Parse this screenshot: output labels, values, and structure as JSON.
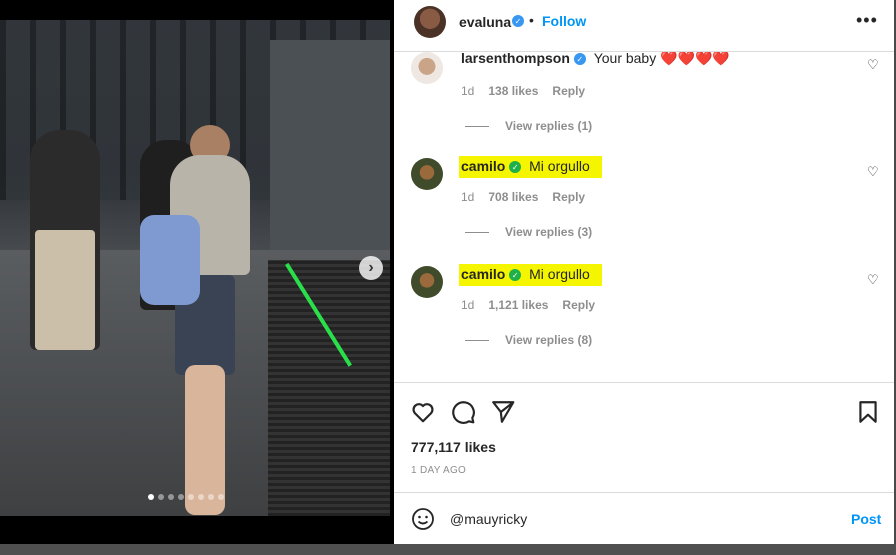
{
  "post": {
    "author": "evaluna",
    "follow_label": "Follow",
    "separator": "•",
    "more_label": "•••",
    "likes": "777,117 likes",
    "time": "1 DAY AGO"
  },
  "photo": {
    "next_label": "›",
    "dots_count": 8,
    "active_dot": 1
  },
  "comments": [
    {
      "username": "larsenthompson",
      "text": "Your baby ❤️❤️❤️❤️",
      "age": "1d",
      "likes": "138 likes",
      "reply_label": "Reply",
      "view_replies": "View replies (1)",
      "highlighted": false
    },
    {
      "username": "camilo",
      "text": "Mi orgullo",
      "age": "1d",
      "likes": "708 likes",
      "reply_label": "Reply",
      "view_replies": "View replies (3)",
      "highlighted": true
    },
    {
      "username": "camilo",
      "text": "Mi orgullo",
      "age": "1d",
      "likes": "1,121 likes",
      "reply_label": "Reply",
      "view_replies": "View replies (8)",
      "highlighted": true
    }
  ],
  "composer": {
    "value": "@mauyricky",
    "post_label": "Post"
  },
  "colors": {
    "accent": "#0095f6",
    "verified": "#3897f0",
    "highlight": "#f5f500"
  },
  "icons": [
    "heart-icon",
    "comment-icon",
    "share-icon",
    "bookmark-icon",
    "emoji-icon",
    "verified-icon",
    "more-icon"
  ]
}
